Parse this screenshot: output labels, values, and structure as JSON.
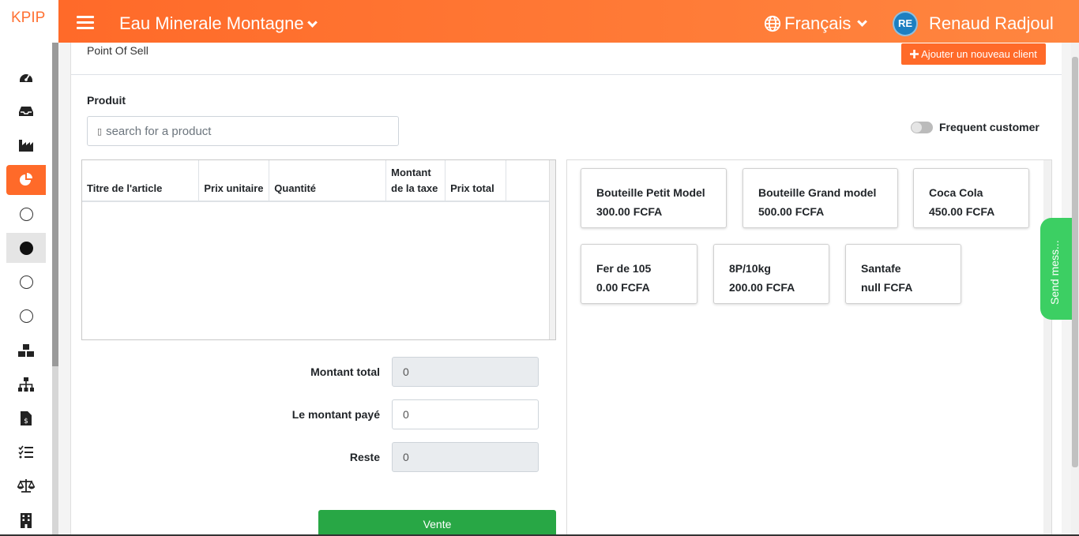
{
  "app": {
    "brand": "KPIP"
  },
  "topbar": {
    "company": "Eau Minerale Montagne",
    "language": "Français",
    "user_initials": "RE",
    "user_name": "Renaud Radjoul"
  },
  "page": {
    "title": "Point Of Sell",
    "add_client_label": "Ajouter un nouveau client"
  },
  "product_section": {
    "label": "Produit",
    "search_placeholder": "search for a product",
    "frequent_customer_label": "Frequent customer",
    "frequent_customer_on": false
  },
  "cart_table": {
    "headers": {
      "title": "Titre de l'article",
      "unit_price": "Prix unitaire",
      "quantity": "Quantité",
      "tax_line1": "Montant",
      "tax_line2": "de la taxe",
      "total_price": "Prix total"
    },
    "rows": []
  },
  "summary": {
    "total_label": "Montant total",
    "total_value": "0",
    "paid_label": "Le montant payé",
    "paid_value": "0",
    "rest_label": "Reste",
    "rest_value": "0"
  },
  "sell_button": "Vente",
  "products": [
    {
      "name": "Bouteille Petit Model",
      "price": "300.00 FCFA"
    },
    {
      "name": "Bouteille Grand model",
      "price": "500.00 FCFA"
    },
    {
      "name": "Coca Cola",
      "price": "450.00 FCFA"
    },
    {
      "name": "Fer de 105",
      "price": "0.00 FCFA"
    },
    {
      "name": "8P/10kg",
      "price": "200.00 FCFA"
    },
    {
      "name": "Santafe",
      "price": "null FCFA"
    }
  ],
  "chat_tab": "Send mess...",
  "colors": {
    "accent": "#ff6a29",
    "success": "#28a745",
    "chat": "#3ccf63",
    "avatar": "#1d7fc1"
  },
  "sidebar_icons": [
    "dashboard-icon",
    "inbox-icon",
    "industry-icon",
    "pie-chart-icon",
    "circle-icon",
    "circle-filled-icon",
    "circle-icon",
    "circle-icon",
    "boxes-icon",
    "sitemap-icon",
    "invoice-icon",
    "tasks-icon",
    "balance-scale-icon",
    "building-icon"
  ]
}
